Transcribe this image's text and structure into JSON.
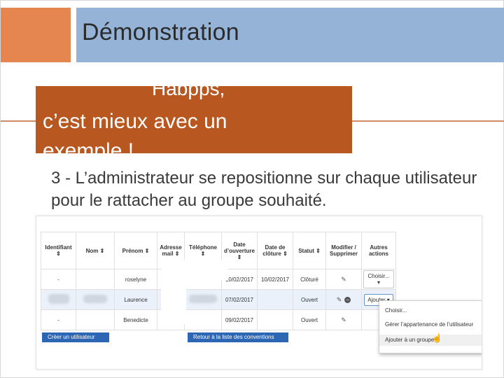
{
  "slide": {
    "title": "Démonstration",
    "callout": {
      "line1": "Habpps,",
      "line2": "c’est mieux avec un",
      "line3": "exemple !"
    },
    "body": "3 - L’administrateur se repositionne sur chaque utilisateur pour le rattacher au groupe souhaité."
  },
  "colors": {
    "accent_orange": "#e5854f",
    "title_bar_blue": "#95b3d7",
    "callout_bg": "#b85820",
    "button_blue": "#2d67b3"
  },
  "screenshot": {
    "columns": [
      "Identifiant ⇕",
      "Nom ⇕",
      "Prénom ⇕",
      "Adresse mail ⇕",
      "Téléphone ⇕",
      "Date d’ouverture ⇕",
      "Date de clôture ⇕",
      "Statut ⇕",
      "Modifier / Supprimer",
      "Autres actions"
    ],
    "rows": [
      {
        "prenom": "roselyne",
        "ouverture": "10/02/2017",
        "cloture": "10/02/2017",
        "statut": "Clôturé",
        "action": "Choisir..."
      },
      {
        "prenom": "Laurence",
        "ouverture": "07/02/2017",
        "cloture": "",
        "statut": "Ouvert",
        "action": "Ajouter"
      },
      {
        "prenom": "Benedicte",
        "ouverture": "09/02/2017",
        "cloture": "",
        "statut": "Ouvert",
        "action": ""
      }
    ],
    "create_button": "Créer un utilisateur",
    "back_button": "Retour à la liste des conventions",
    "dropdown_options": [
      "Choisir...",
      "Gérer l’appartenance de l’utilisateur",
      "Ajouter à un groupe"
    ]
  }
}
